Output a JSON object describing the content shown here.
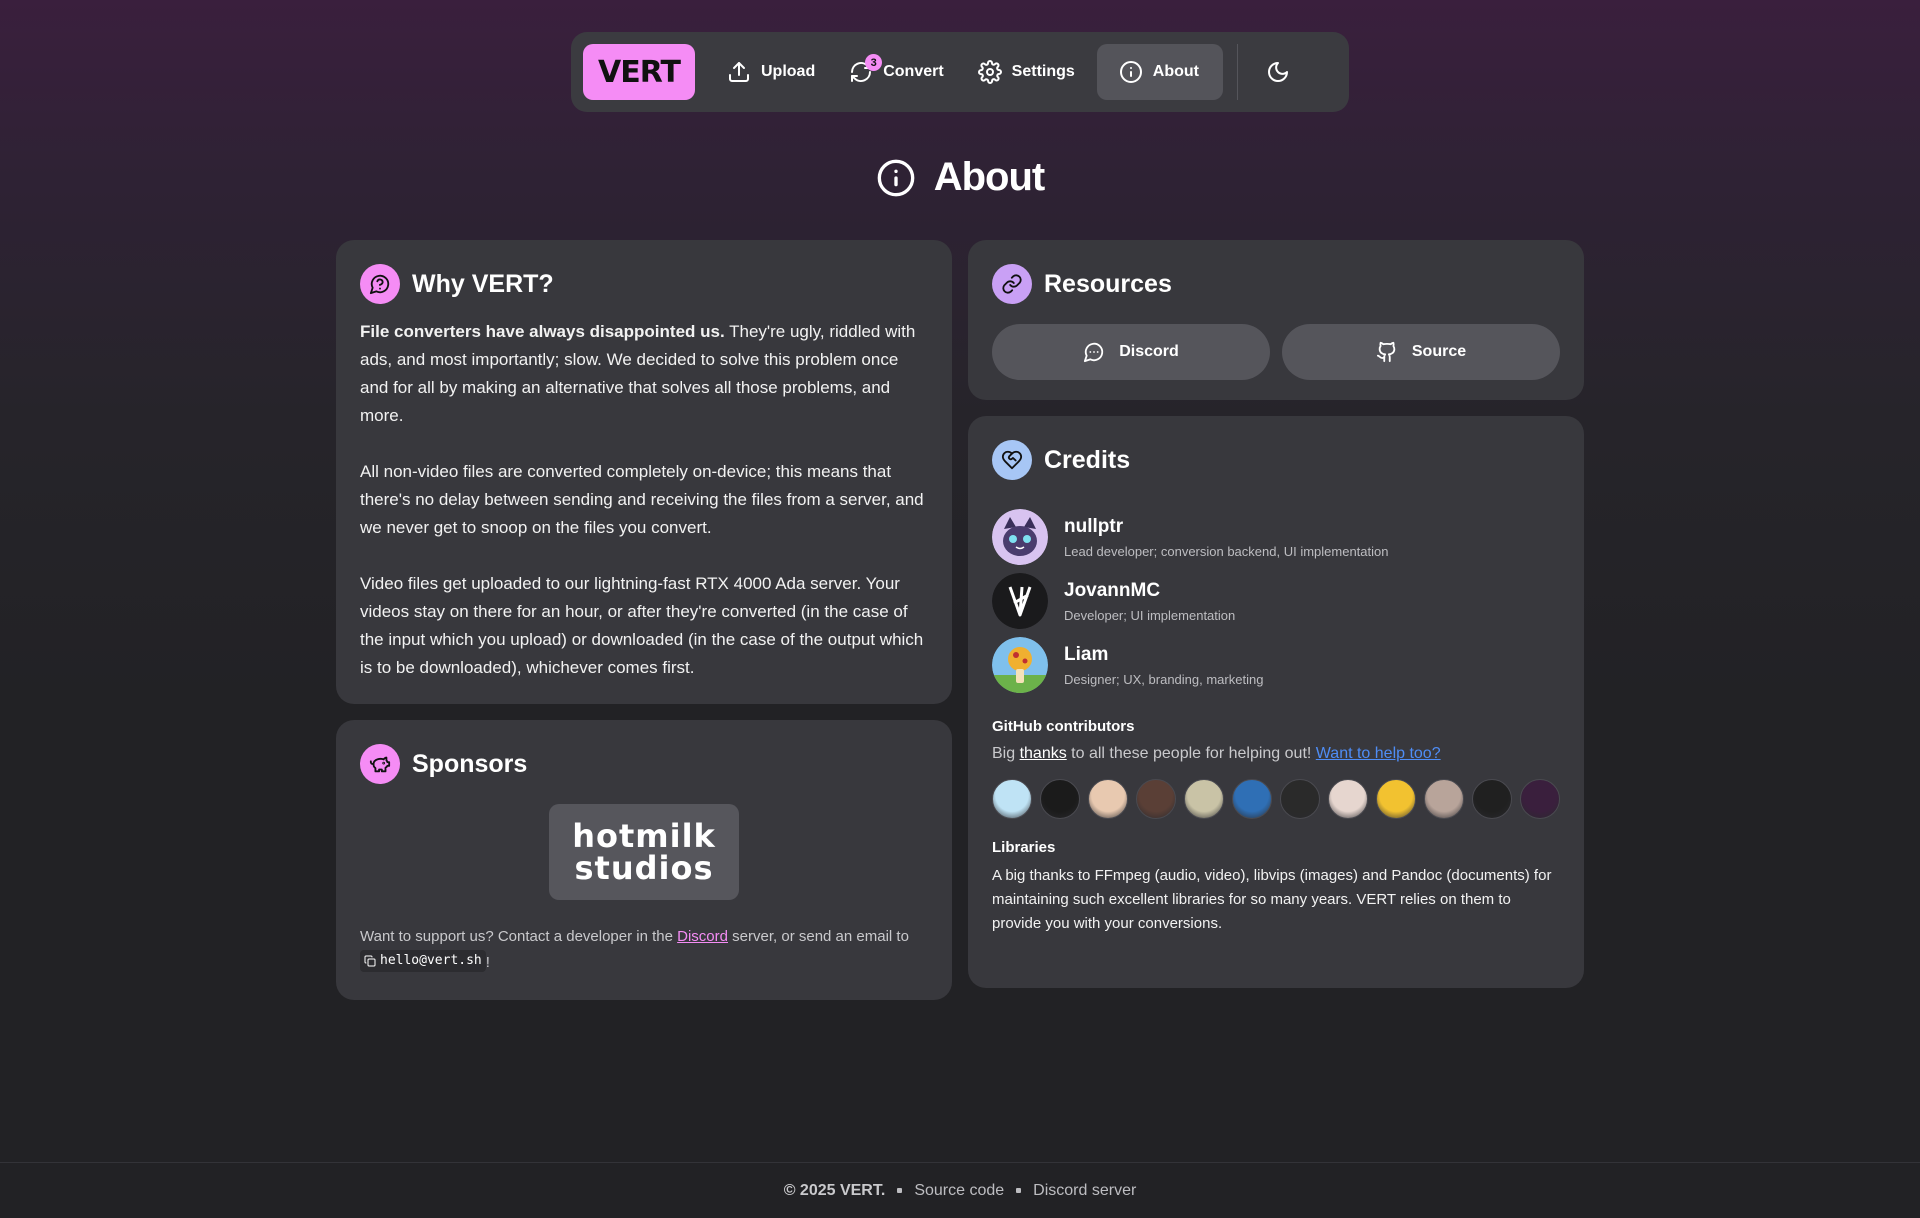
{
  "nav": {
    "logo": "VERT",
    "items": [
      {
        "label": "Upload",
        "icon": "upload-icon"
      },
      {
        "label": "Convert",
        "icon": "refresh-icon",
        "badge": "3"
      },
      {
        "label": "Settings",
        "icon": "gear-icon"
      },
      {
        "label": "About",
        "icon": "info-icon",
        "active": true
      }
    ],
    "theme_icon": "moon-icon"
  },
  "page": {
    "title": "About",
    "title_icon": "info-icon"
  },
  "why": {
    "title": "Why VERT?",
    "icon": "question-bubble-icon",
    "p1_lead": "File converters have always disappointed us.",
    "p1_rest": " They're ugly, riddled with ads, and most importantly; slow. We decided to solve this problem once and for all by making an alternative that solves all those problems, and more.",
    "p2": "All non-video files are converted completely on-device; this means that there's no delay between sending and receiving the files from a server, and we never get to snoop on the files you convert.",
    "p3": "Video files get uploaded to our lightning-fast RTX 4000 Ada server. Your videos stay on there for an hour, or after they're converted (in the case of the input which you upload) or downloaded (in the case of the output which is to be downloaded), whichever comes first."
  },
  "sponsors": {
    "title": "Sponsors",
    "icon": "piggy-bank-icon",
    "logo_line1": "hotmilk",
    "logo_line2": "studios",
    "support_pre": "Want to support us? Contact a developer in the ",
    "support_link": "Discord",
    "support_mid": " server, or send an email to ",
    "email": "hello@vert.sh",
    "support_post": "!"
  },
  "resources": {
    "title": "Resources",
    "icon": "link-icon",
    "buttons": [
      {
        "label": "Discord",
        "icon": "chat-bubble-icon"
      },
      {
        "label": "Source",
        "icon": "github-icon"
      }
    ]
  },
  "credits": {
    "title": "Credits",
    "icon": "heart-handshake-icon",
    "people": [
      {
        "name": "nullptr",
        "role": "Lead developer; conversion backend, UI implementation"
      },
      {
        "name": "JovannMC",
        "role": "Developer; UI implementation"
      },
      {
        "name": "Liam",
        "role": "Designer; UX, branding, marketing"
      }
    ],
    "github_label": "GitHub contributors",
    "thanks_pre": "Big ",
    "thanks_word": "thanks",
    "thanks_mid": " to all these people for helping out! ",
    "help_link": "Want to help too?",
    "contributor_colors": [
      "#bfe3f5",
      "#1b1b1b",
      "#e8c9b0",
      "#5a3f36",
      "#c9c3a6",
      "#2f6fb5",
      "#2a2a2a",
      "#e6d6cf",
      "#f2c230",
      "#b8a49a",
      "#202020",
      "#3a1f3d"
    ],
    "libraries_label": "Libraries",
    "libraries_text": "A big thanks to FFmpeg (audio, video), libvips (images) and Pandoc (documents) for maintaining such excellent libraries for so many years. VERT relies on them to provide you with your conversions."
  },
  "footer": {
    "copyright": "© 2025 VERT.",
    "links": [
      "Source code",
      "Discord server"
    ]
  },
  "colors": {
    "accent": "#f58cf5",
    "accent_purple": "#c9a0f5",
    "accent_blue": "#a7c6f5",
    "link_blue": "#4f8df5"
  }
}
